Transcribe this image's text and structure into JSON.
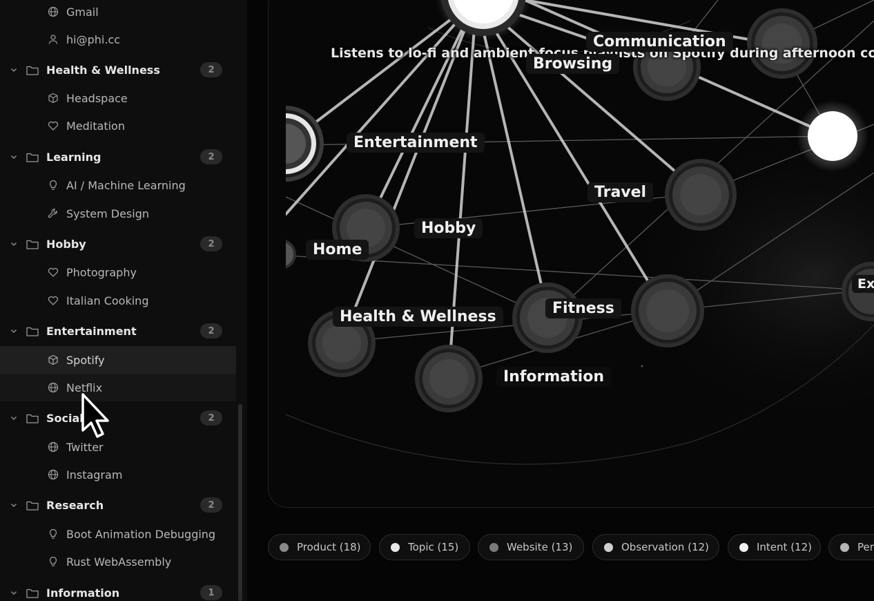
{
  "sidebar": {
    "top_items": [
      {
        "label": "Gmail",
        "icon": "globe-icon"
      },
      {
        "label": "hi@phi.cc",
        "icon": "person-icon"
      }
    ],
    "groups": [
      {
        "label": "Health & Wellness",
        "count": "2",
        "items": [
          {
            "label": "Headspace",
            "icon": "cube-icon"
          },
          {
            "label": "Meditation",
            "icon": "heart-icon"
          }
        ]
      },
      {
        "label": "Learning",
        "count": "2",
        "items": [
          {
            "label": "AI / Machine Learning",
            "icon": "lightbulb-icon"
          },
          {
            "label": "System Design",
            "icon": "wrench-icon"
          }
        ]
      },
      {
        "label": "Hobby",
        "count": "2",
        "items": [
          {
            "label": "Photography",
            "icon": "heart-icon"
          },
          {
            "label": "Italian Cooking",
            "icon": "heart-icon"
          }
        ]
      },
      {
        "label": "Entertainment",
        "count": "2",
        "items": [
          {
            "label": "Spotify",
            "icon": "cube-icon"
          },
          {
            "label": "Netflix",
            "icon": "globe-icon"
          }
        ]
      },
      {
        "label": "Social",
        "count": "2",
        "items": [
          {
            "label": "Twitter",
            "icon": "globe-icon"
          },
          {
            "label": "Instagram",
            "icon": "globe-icon"
          }
        ]
      },
      {
        "label": "Research",
        "count": "2",
        "items": [
          {
            "label": "Boot Animation Debugging",
            "icon": "lightbulb-icon"
          },
          {
            "label": "Rust WebAssembly",
            "icon": "lightbulb-icon"
          }
        ]
      },
      {
        "label": "Information",
        "count": "1",
        "items": []
      }
    ]
  },
  "graph": {
    "tooltip": "Listens to lo-fi and ambient focus playlists on Spotify during afternoon co",
    "labels": [
      "Communication",
      "Browsing",
      "Entertainment",
      "Travel",
      "Hobby",
      "Home",
      "Health & Wellness",
      "Fitness",
      "Information",
      "Ex"
    ]
  },
  "legend": [
    {
      "label": "Product (18)",
      "color": "#8a8a8a"
    },
    {
      "label": "Topic (15)",
      "color": "#e8e8e8"
    },
    {
      "label": "Website (13)",
      "color": "#7a7a7a"
    },
    {
      "label": "Observation (12)",
      "color": "#cfcfcf"
    },
    {
      "label": "Intent (12)",
      "color": "#f0f0f0"
    },
    {
      "label": "Per",
      "color": "#b5b5b5"
    }
  ]
}
